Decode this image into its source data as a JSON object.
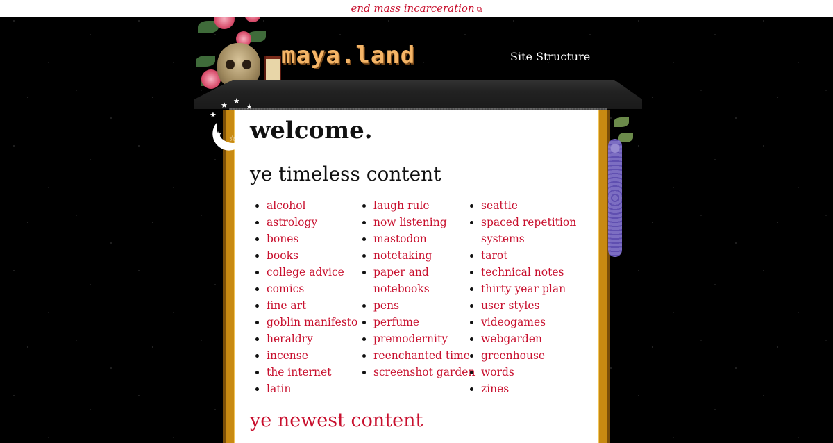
{
  "banner": {
    "text": "end mass incarceration",
    "icon": "external-link-icon"
  },
  "header": {
    "logo": "maya.land",
    "nav_link": "Site Structure"
  },
  "main": {
    "title": "welcome.",
    "section_timeless": "ye timeless content",
    "section_newest": "ye newest content",
    "links_col1": [
      "alcohol",
      "astrology",
      "bones",
      "books",
      "college advice",
      "comics",
      "fine art",
      "goblin manifesto",
      "heraldry",
      "incense",
      "the internet",
      "latin"
    ],
    "links_col2": [
      "laugh rule",
      "now listening",
      "mastodon",
      "notetaking",
      "paper and notebooks",
      "pens",
      "perfume",
      "premodernity",
      "reenchanted time",
      "screenshot garden"
    ],
    "links_col3": [
      "seattle",
      "spaced repetition systems",
      "tarot",
      "technical notes",
      "thirty year plan",
      "user styles",
      "videogames",
      "webgarden",
      "greenhouse",
      "words",
      "zines"
    ]
  },
  "colors": {
    "link": "#c8102e",
    "logo": "#f5b567",
    "frame": "#c88a12",
    "background": "#000000"
  }
}
